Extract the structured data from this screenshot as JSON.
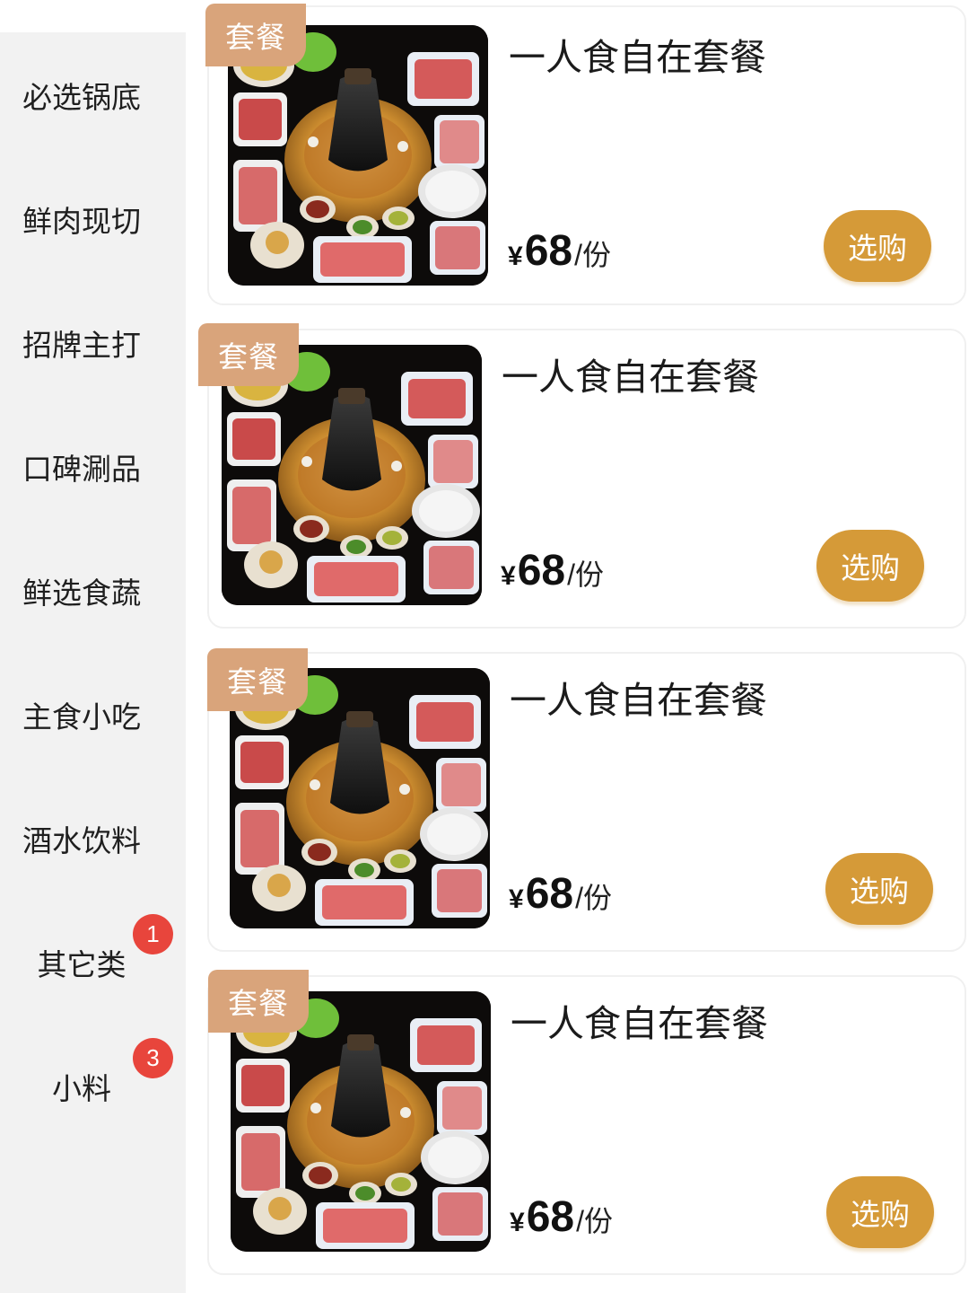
{
  "categories": [
    {
      "label": "必选锅底"
    },
    {
      "label": "鲜肉现切"
    },
    {
      "label": "招牌主打"
    },
    {
      "label": "口碑涮品"
    },
    {
      "label": "鲜选食蔬"
    },
    {
      "label": "主食小吃"
    },
    {
      "label": "酒水饮料"
    },
    {
      "label": "其它类",
      "badge": "1"
    },
    {
      "label": "小料",
      "badge": "3"
    }
  ],
  "products": [
    {
      "tag": "套餐",
      "title": "一人食自在套餐",
      "currency": "¥",
      "price": "68",
      "unit": "/份",
      "button": "选购",
      "image_icon": "hotpot-set-image"
    },
    {
      "tag": "套餐",
      "title": "一人食自在套餐",
      "currency": "¥",
      "price": "68",
      "unit": "/份",
      "button": "选购",
      "image_icon": "hotpot-set-image"
    },
    {
      "tag": "套餐",
      "title": "一人食自在套餐",
      "currency": "¥",
      "price": "68",
      "unit": "/份",
      "button": "选购",
      "image_icon": "hotpot-set-image"
    },
    {
      "tag": "套餐",
      "title": "一人食自在套餐",
      "currency": "¥",
      "price": "68",
      "unit": "/份",
      "button": "选购",
      "image_icon": "hotpot-set-image"
    }
  ],
  "colors": {
    "sidebar_bg": "#f2f2f2",
    "tag_bg": "#d9a47b",
    "button_bg": "#d59a38",
    "badge_bg": "#e8453c"
  }
}
